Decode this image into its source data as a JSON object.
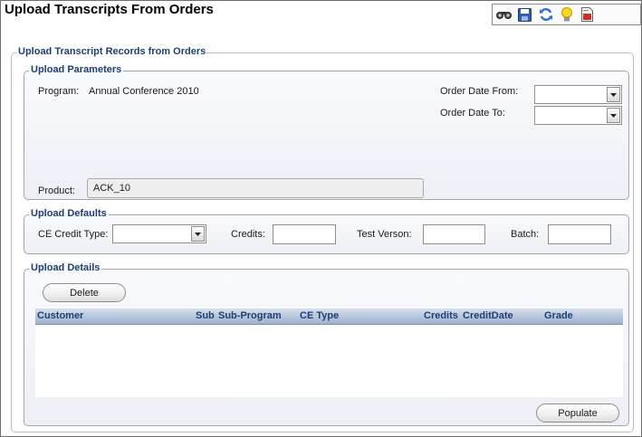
{
  "page": {
    "title": "Upload Transcripts From Orders"
  },
  "toolbar": {
    "icons": [
      "binoculars-icon",
      "save-icon",
      "refresh-icon",
      "lightbulb-icon",
      "report-icon"
    ]
  },
  "section": {
    "title": "Upload Transcript Records from Orders"
  },
  "parameters": {
    "title": "Upload Parameters",
    "program_label": "Program:",
    "program_value": "Annual Conference 2010",
    "order_date_from_label": "Order Date From:",
    "order_date_from_value": "",
    "order_date_to_label": "Order Date To:",
    "order_date_to_value": "",
    "product_label": "Product:",
    "product_value": "ACK_10"
  },
  "defaults": {
    "title": "Upload Defaults",
    "ce_credit_type_label": "CE Credit Type:",
    "ce_credit_type_value": "",
    "credits_label": "Credits:",
    "credits_value": "",
    "test_version_label": "Test Verson:",
    "test_version_value": "",
    "batch_label": "Batch:",
    "batch_value": ""
  },
  "details": {
    "title": "Upload Details",
    "delete_label": "Delete",
    "columns": [
      "Customer",
      "Sub",
      "Sub-Program",
      "CE Type",
      "Credits",
      "CreditDate",
      "Grade"
    ],
    "rows": [],
    "populate_label": "Populate"
  },
  "colors": {
    "legend_text": "#1f3f72",
    "group_border": "#9ea6b6",
    "grid_header": "#b4c3da"
  }
}
